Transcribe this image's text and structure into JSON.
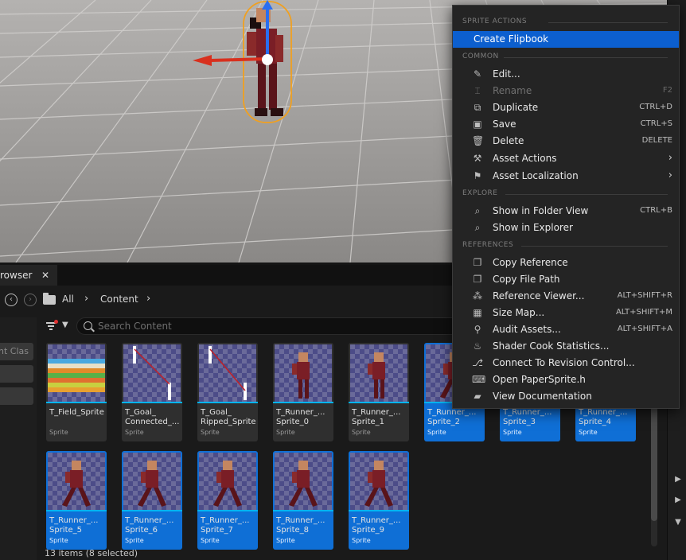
{
  "content_browser": {
    "tab_label": "rowser",
    "tab_close": "✕",
    "breadcrumb": [
      "All",
      "Content"
    ],
    "search_placeholder": "Search Content",
    "left_buttons": [
      "nt Clas",
      "",
      ""
    ],
    "status": "13 items (8 selected)",
    "assets": [
      {
        "name": "T_Field_Sprite",
        "type": "Sprite",
        "selected": false
      },
      {
        "name": "T_Goal_\nConnected_...",
        "type": "Sprite",
        "selected": false
      },
      {
        "name": "T_Goal_\nRipped_Sprite",
        "type": "Sprite",
        "selected": false
      },
      {
        "name": "T_Runner_...\nSprite_0",
        "type": "Sprite",
        "selected": false
      },
      {
        "name": "T_Runner_...\nSprite_1",
        "type": "Sprite",
        "selected": false
      },
      {
        "name": "T_Runner_...\nSprite_2",
        "type": "Sprite",
        "selected": true
      },
      {
        "name": "T_Runner_...\nSprite_3",
        "type": "Sprite",
        "selected": true
      },
      {
        "name": "T_Runner_...\nSprite_4",
        "type": "Sprite",
        "selected": true
      },
      {
        "name": "T_Runner_...\nSprite_5",
        "type": "Sprite",
        "selected": true
      },
      {
        "name": "T_Runner_...\nSprite_6",
        "type": "Sprite",
        "selected": true
      },
      {
        "name": "T_Runner_...\nSprite_7",
        "type": "Sprite",
        "selected": true
      },
      {
        "name": "T_Runner_...\nSprite_8",
        "type": "Sprite",
        "selected": true
      },
      {
        "name": "T_Runner_...\nSprite_9",
        "type": "Sprite",
        "selected": true
      }
    ]
  },
  "context_menu": {
    "sections": {
      "sprite_actions": "SPRITE ACTIONS",
      "common": "COMMON",
      "explore": "EXPLORE",
      "references": "REFERENCES"
    },
    "items": {
      "create_flipbook": {
        "label": "Create Flipbook"
      },
      "edit": {
        "label": "Edit...",
        "icon": "pencil-icon"
      },
      "rename": {
        "label": "Rename",
        "shortcut": "F2",
        "icon": "rename-icon",
        "disabled": true
      },
      "duplicate": {
        "label": "Duplicate",
        "shortcut": "CTRL+D",
        "icon": "duplicate-icon"
      },
      "save": {
        "label": "Save",
        "shortcut": "CTRL+S",
        "icon": "save-icon"
      },
      "delete": {
        "label": "Delete",
        "shortcut": "DELETE",
        "icon": "trash-icon"
      },
      "asset_actions": {
        "label": "Asset Actions",
        "icon": "wrench-icon"
      },
      "asset_localization": {
        "label": "Asset Localization",
        "icon": "flag-icon"
      },
      "show_folder_view": {
        "label": "Show in Folder View",
        "shortcut": "CTRL+B",
        "icon": "folder-search-icon"
      },
      "show_explorer": {
        "label": "Show in Explorer",
        "icon": "folder-search-icon"
      },
      "copy_reference": {
        "label": "Copy Reference",
        "icon": "copy-icon"
      },
      "copy_file_path": {
        "label": "Copy File Path",
        "icon": "copy-icon"
      },
      "reference_viewer": {
        "label": "Reference Viewer...",
        "shortcut": "ALT+SHIFT+R",
        "icon": "graph-icon"
      },
      "size_map": {
        "label": "Size Map...",
        "shortcut": "ALT+SHIFT+M",
        "icon": "size-map-icon"
      },
      "audit_assets": {
        "label": "Audit Assets...",
        "shortcut": "ALT+SHIFT+A",
        "icon": "audit-icon"
      },
      "shader_cook": {
        "label": "Shader Cook Statistics...",
        "icon": "shader-icon"
      },
      "revision_control": {
        "label": "Connect To Revision Control...",
        "icon": "revision-icon"
      },
      "open_papersprite": {
        "label": "Open PaperSprite.h",
        "icon": "code-icon"
      },
      "view_documentation": {
        "label": "View Documentation",
        "icon": "book-icon"
      }
    }
  },
  "colors": {
    "selection_blue": "#0f6fd6",
    "menu_highlight": "#0c5fcf",
    "asset_strip": "#00b4f0",
    "gizmo_red": "#d8301e",
    "gizmo_blue": "#2a6ef0",
    "selection_outline": "#f0a020"
  }
}
